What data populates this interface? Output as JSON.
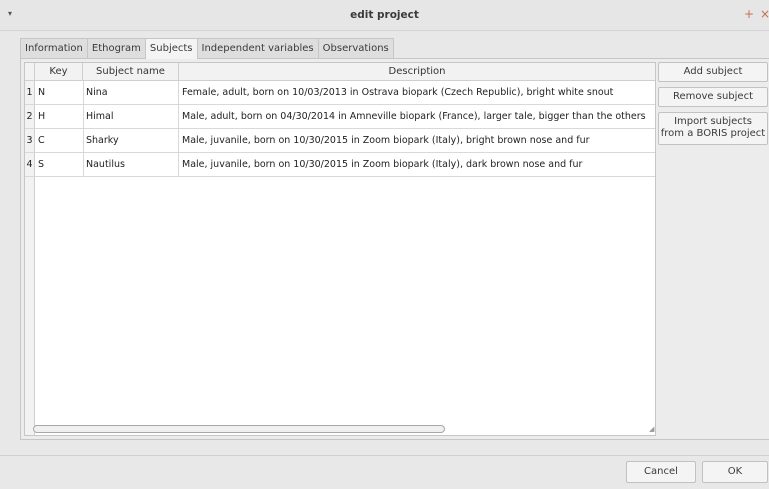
{
  "window": {
    "title": "edit project",
    "menu_glyph": "▾",
    "plus_glyph": "+",
    "close_glyph": "×"
  },
  "tabs": [
    {
      "label": "Information"
    },
    {
      "label": "Ethogram"
    },
    {
      "label": "Subjects",
      "active": true
    },
    {
      "label": "Independent variables"
    },
    {
      "label": "Observations"
    }
  ],
  "table": {
    "headers": {
      "key": "Key",
      "name": "Subject name",
      "description": "Description"
    },
    "rows": [
      {
        "num": "1",
        "key": "N",
        "name": "Nina",
        "description": "Female, adult, born on 10/03/2013 in Ostrava biopark (Czech Republic), bright white snout"
      },
      {
        "num": "2",
        "key": "H",
        "name": "Himal",
        "description": "Male, adult, born on 04/30/2014 in Amneville biopark (France), larger tale, bigger than the others"
      },
      {
        "num": "3",
        "key": "C",
        "name": "Sharky",
        "description": "Male, juvanile, born on 10/30/2015 in Zoom biopark (Italy), bright brown nose and fur"
      },
      {
        "num": "4",
        "key": "S",
        "name": "Nautilus",
        "description": "Male, juvanile, born on 10/30/2015 in Zoom biopark (Italy), dark brown nose and fur"
      }
    ]
  },
  "buttons": {
    "add_subject": "Add subject",
    "remove_subject": "Remove subject",
    "import_line1": "Import subjects",
    "import_line2": "from a BORIS project",
    "cancel": "Cancel",
    "ok": "OK"
  },
  "colors": {
    "accent_close": "#c96e55",
    "background": "#e8e8e8"
  }
}
